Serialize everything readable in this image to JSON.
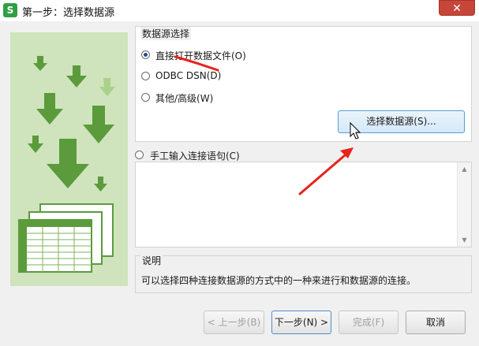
{
  "window": {
    "title": "第一步：选择数据源",
    "app_icon_letter": "S",
    "close_symbol": "✕"
  },
  "source_group": {
    "legend": "数据源选择",
    "options": [
      {
        "label": "直接打开数据文件(O)",
        "checked": true
      },
      {
        "label": "ODBC DSN(D)",
        "checked": false
      },
      {
        "label": "其他/高级(W)",
        "checked": false
      }
    ],
    "select_button": "选择数据源(S)..."
  },
  "manual": {
    "label": "手工输入连接语句(C)",
    "text": "",
    "scroll_up_icon": "triangle-up",
    "scroll_down_icon": "triangle-down"
  },
  "description": {
    "legend": "说明",
    "text": "可以选择四种连接数据源的方式中的一种来进行和数据源的连接。"
  },
  "buttons": {
    "prev": "< 上一步(B)",
    "next": "下一步(N) >",
    "finish": "完成(F)",
    "cancel": "取消"
  },
  "colors": {
    "accent_green": "#5a9e3a",
    "annotation_red": "#e8231c",
    "button_focus_blue": "#5a9bd5"
  }
}
